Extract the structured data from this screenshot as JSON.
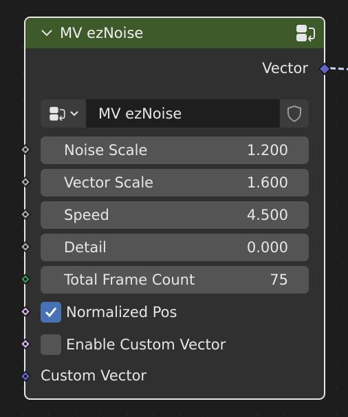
{
  "node": {
    "title": "MV ezNoise",
    "output_label": "Vector",
    "selector_name": "MV ezNoise",
    "fields": [
      {
        "label": "Noise Scale",
        "value": "1.200"
      },
      {
        "label": "Vector Scale",
        "value": "1.600"
      },
      {
        "label": "Speed",
        "value": "4.500"
      },
      {
        "label": "Detail",
        "value": "0.000"
      },
      {
        "label": "Total Frame Count",
        "value": "75"
      }
    ],
    "checkboxes": [
      {
        "label": "Normalized Pos",
        "checked": true
      },
      {
        "label": "Enable Custom Vector",
        "checked": false
      }
    ],
    "input_label": "Custom Vector"
  },
  "colors": {
    "header": "#3e5a2a",
    "float_socket": "#a1a1a1",
    "int_socket": "#3d8c55",
    "bool_socket": "#ccaadd",
    "vector_socket": "#6363c7",
    "checkbox_on": "#4772b3"
  },
  "icons": {
    "collapse": "chevron-down-icon",
    "node_group": "node-group-icon",
    "fake_user": "shield-icon"
  }
}
